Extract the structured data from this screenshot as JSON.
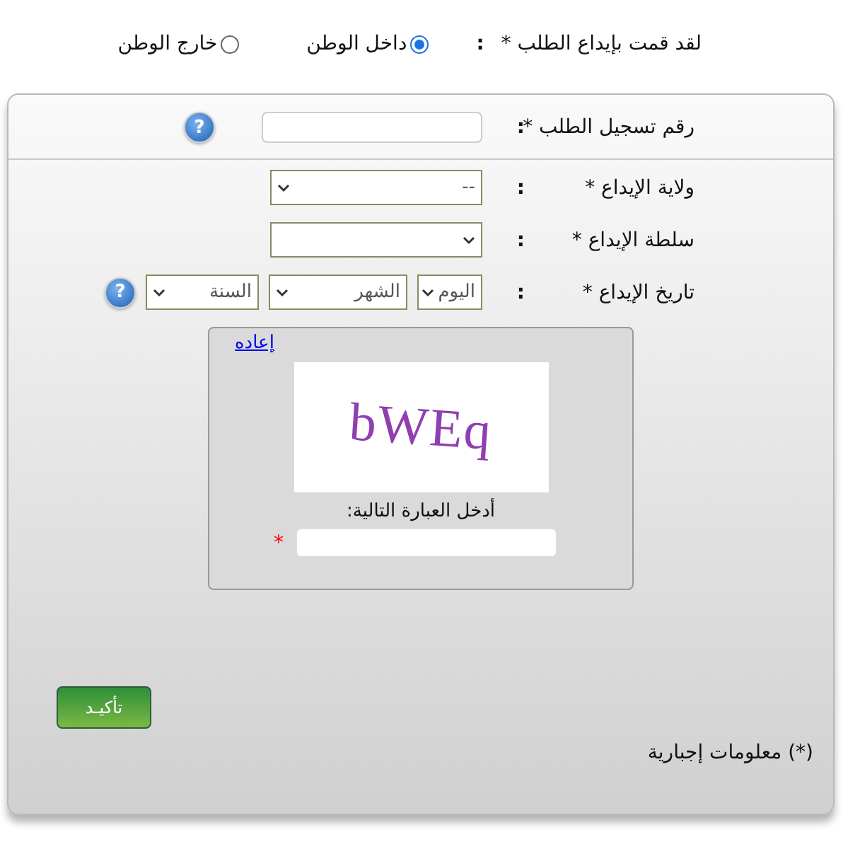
{
  "residence": {
    "label": "لقد قمت بإيداع الطلب *",
    "colon": ":",
    "options": [
      {
        "label": "داخل الوطن",
        "selected": true
      },
      {
        "label": "خارج الوطن",
        "selected": false
      }
    ]
  },
  "fields": [
    {
      "kind": "text",
      "label": "رقم تسجيل الطلب *",
      "colon": ":",
      "help": "?"
    },
    {
      "kind": "select",
      "label": "ولاية الإيداع *",
      "colon": ":",
      "value": "--"
    },
    {
      "kind": "select",
      "label": "سلطة الإيداع *",
      "colon": ":"
    },
    {
      "kind": "date",
      "label": "تاريخ الإيداع *",
      "colon": ":",
      "parts": [
        "اليوم",
        "الشهر",
        "السنة"
      ],
      "help": "?"
    }
  ],
  "captcha": {
    "refresh_link": "إعاده",
    "image_text": "bWEq",
    "prompt": "أدخل العبارة التالية:",
    "required_mark": "*"
  },
  "submit": "تأكيـد",
  "footnote": "(*) معلومات إجبارية"
}
